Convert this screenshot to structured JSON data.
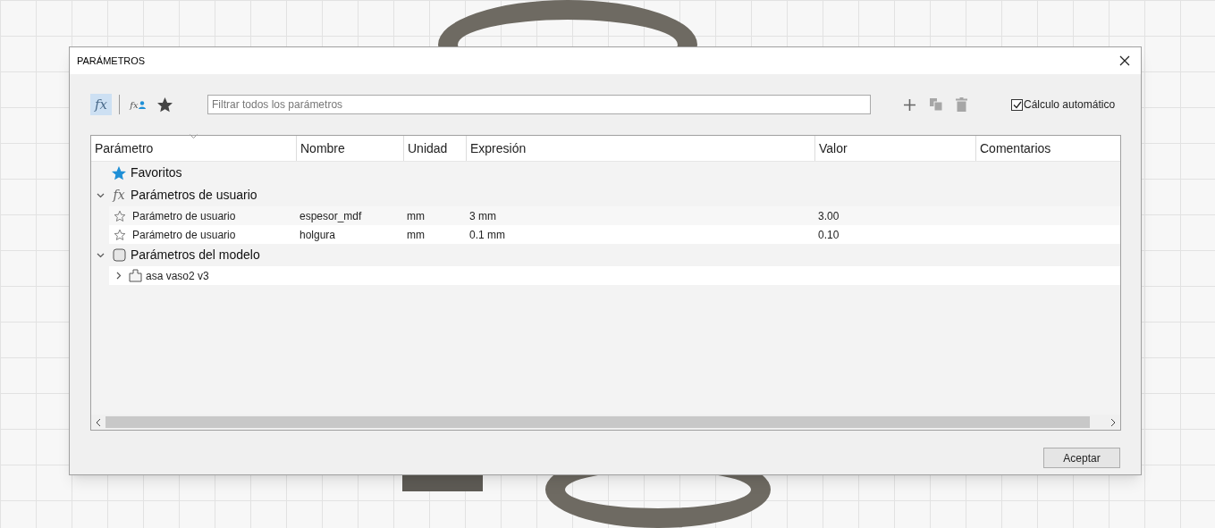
{
  "dialog": {
    "title": "PARÁMETROS"
  },
  "filters": [
    {
      "kind": "all",
      "label": "fx",
      "selected": true
    },
    {
      "kind": "user",
      "label": "fx",
      "selected": false
    },
    {
      "kind": "favorites",
      "selected": false
    }
  ],
  "search": {
    "placeholder": "Filtrar todos los parámetros"
  },
  "actions": [
    {
      "kind": "add",
      "disabled": false
    },
    {
      "kind": "copy",
      "disabled": true
    },
    {
      "kind": "delete",
      "disabled": true
    }
  ],
  "auto_calc": {
    "label": "Cálculo automático",
    "checked": true
  },
  "table": {
    "columns": [
      "Parámetro",
      "Nombre",
      "Unidad",
      "Expresión",
      "Valor",
      "Comentarios"
    ],
    "groups": [
      {
        "kind": "favorites",
        "label": "Favoritos"
      },
      {
        "kind": "user",
        "icon_text": "fx",
        "label": "Parámetros de usuario",
        "expanded": true,
        "children": [
          {
            "kind": "parameter",
            "favorite": false,
            "parameter": "Parámetro de usuario",
            "name": "espesor_mdf",
            "unit": "mm",
            "expression": "3 mm",
            "value": "3.00"
          },
          {
            "kind": "parameter",
            "favorite": false,
            "parameter": "Parámetro de usuario",
            "name": "holgura",
            "unit": "mm",
            "expression": "0.1 mm",
            "value": "0.10"
          }
        ]
      },
      {
        "kind": "model",
        "label": "Parámetros del modelo",
        "expanded": true,
        "children": [
          {
            "kind": "component",
            "label": "asa vaso2 v3",
            "expanded": false
          }
        ]
      }
    ]
  },
  "buttons": [
    {
      "label": "Aceptar"
    }
  ]
}
